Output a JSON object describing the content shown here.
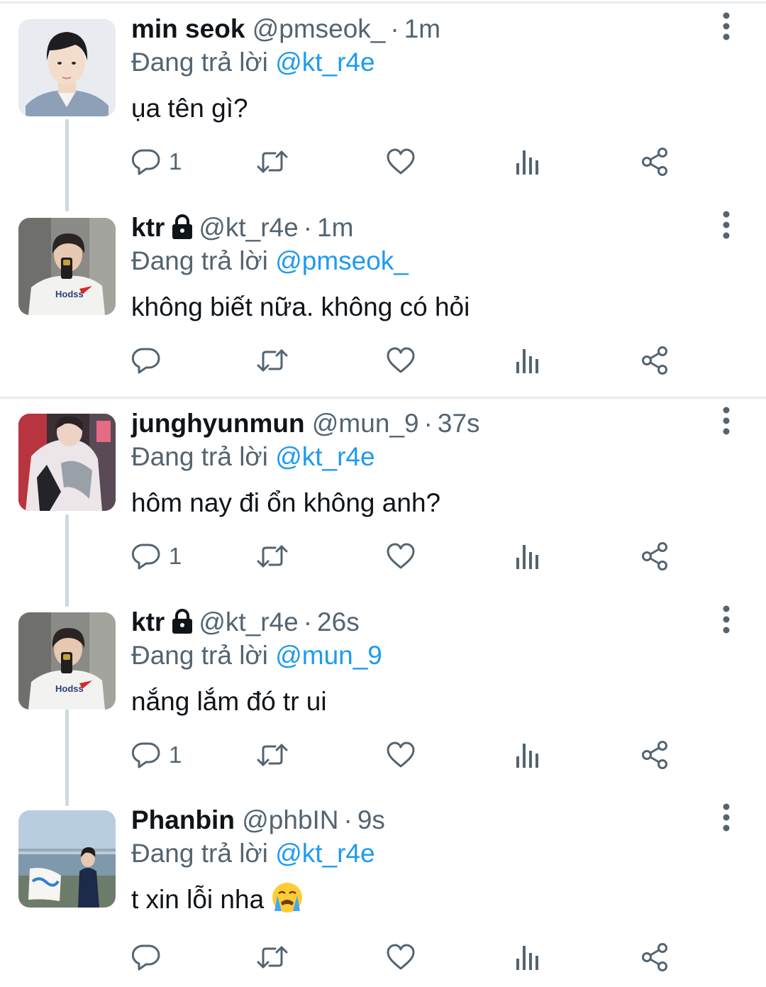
{
  "reply_prefix": "Đang trả lời",
  "tweets": [
    {
      "name": "min seok",
      "handle": "@pmseok_",
      "time": "1m",
      "locked": false,
      "reply_to": "@kt_r4e",
      "text": "ụa tên gì?",
      "reply_count": "1",
      "avatar": "avatar-minseok"
    },
    {
      "name": "ktr",
      "handle": "@kt_r4e",
      "time": "1m",
      "locked": true,
      "reply_to": "@pmseok_",
      "text": "không biết nữa. không có hỏi",
      "reply_count": "",
      "avatar": "avatar-ktr"
    },
    {
      "name": "junghyunmun",
      "handle": "@mun_9",
      "time": "37s",
      "locked": false,
      "reply_to": "@kt_r4e",
      "text": "hôm nay đi ổn không anh?",
      "reply_count": "1",
      "avatar": "avatar-junghyunmun"
    },
    {
      "name": "ktr",
      "handle": "@kt_r4e",
      "time": "26s",
      "locked": true,
      "reply_to": "@mun_9",
      "text": "nắng lắm đó tr ui",
      "reply_count": "1",
      "avatar": "avatar-ktr"
    },
    {
      "name": "Phanbin",
      "handle": "@phbIN",
      "time": "9s",
      "locked": false,
      "reply_to": "@kt_r4e",
      "text": "t xin lỗi nha",
      "emoji": "😭",
      "reply_count": "",
      "avatar": "avatar-phanbin"
    }
  ],
  "icons": {
    "reply": "reply-icon",
    "retweet": "retweet-icon",
    "like": "like-icon",
    "views": "views-icon",
    "share": "share-icon",
    "more": "more-icon",
    "lock": "lock-icon"
  },
  "colors": {
    "link": "#1d9bf0",
    "secondary": "#536471",
    "text": "#0f1419",
    "thread": "#cfd9de"
  }
}
